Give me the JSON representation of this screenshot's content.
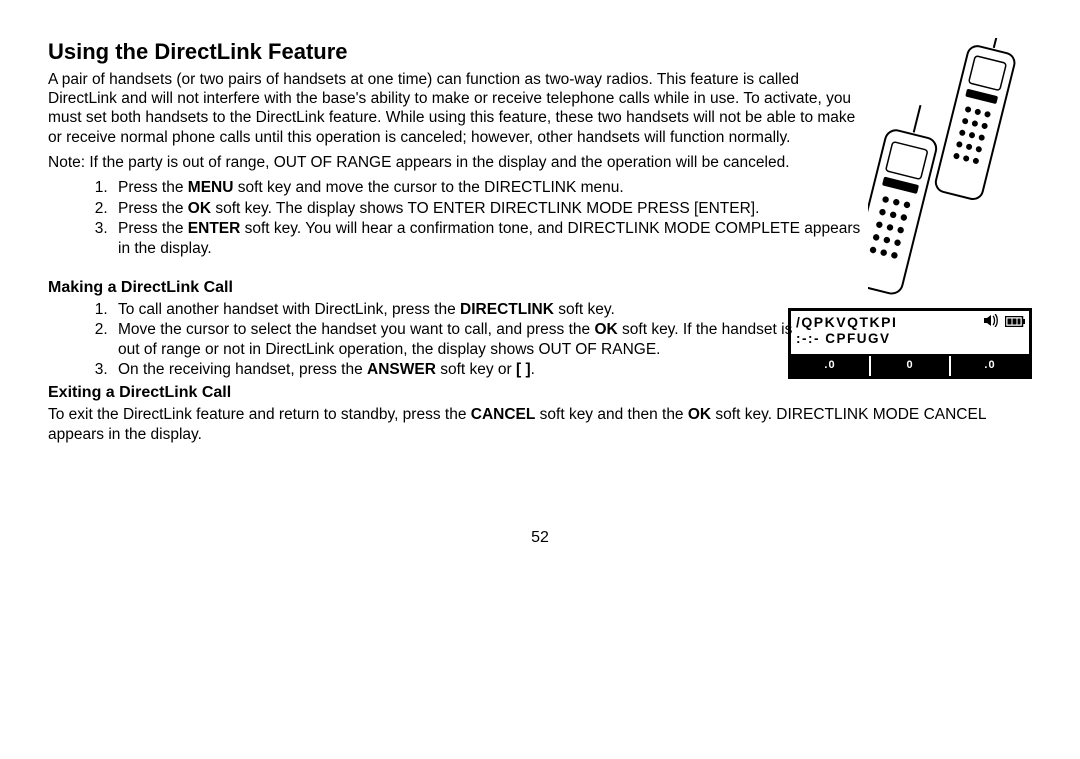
{
  "title": "Using the DirectLink Feature",
  "intro": "A pair of handsets (or two pairs of handsets at one time) can function as two-way radios. This fea­ture is called DirectLink and will not interfere with the base's ability to make or receive telephone calls while in use. To activate, you must set both handsets to the DirectLink feature. While using this feature, these two handsets will not be able to make or receive normal phone calls until this operation is canceled; however, other handsets will function normally.",
  "note": "Note: If the party is out of range, OUT OF RANGE appears in the display and the operation will be canceled.",
  "stepsA": {
    "s1a": "Press the ",
    "s1b": "MENU",
    "s1c": " soft key and move the cursor to the DIRECTLINK menu.",
    "s2a": "Press the ",
    "s2b": "OK",
    "s2c": " soft key. The display shows TO ENTER DIRECTLINK MODE PRESS [ENTER].",
    "s3a": "Press the ",
    "s3b": "ENTER",
    "s3c": " soft key. You will hear a confirmation tone, and DIRECTLINK MODE COMPLETE appears in the display."
  },
  "making_heading": "Making a DirectLink Call",
  "stepsB": {
    "s1a": "To call another handset with DirectLink, press the ",
    "s1b": "DIRECTLINK",
    "s1c": " soft key.",
    "s2a": "Move the cursor to select the handset you want to call, and press the ",
    "s2b": "OK",
    "s2c": " soft key. If the handset is out of range or not in DirectLink operation, the display shows OUT OF RANGE.",
    "s3a": "On the receiving handset, press the ",
    "s3b": "ANSWER",
    "s3c": " soft key or ",
    "s3d": "[           ]",
    "s3e": "."
  },
  "exit_heading": "Exiting a DirectLink Call",
  "exit_a": "To exit the DirectLink feature and return to standby, press the ",
  "exit_b": "CANCEL",
  "exit_c": " soft key and then the ",
  "exit_d": "OK",
  "exit_e": " soft key. DI­RECTLINK MODE CANCEL appears in the display.",
  "lcd": {
    "line1": "/QPKVQTKPI",
    "line2": ":-:- CPFUGV",
    "tabs": [
      ".0",
      "0",
      ".0"
    ]
  },
  "page": "52",
  "icons": {
    "handset_pair": "handset-pair-illustration",
    "speaker": "speaker-icon",
    "battery": "battery-icon",
    "talk": "bracket-icon"
  }
}
